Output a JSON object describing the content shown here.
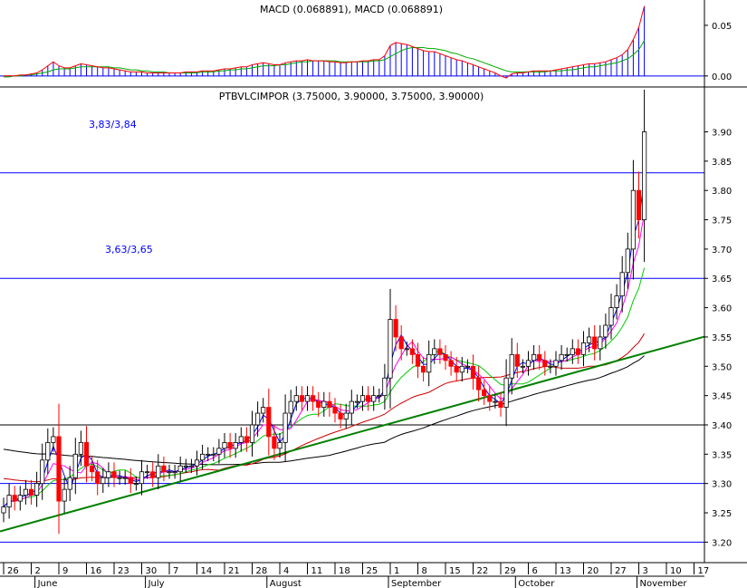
{
  "chart_data": {
    "type": "candlestick",
    "colors": {
      "background": "#ffffff",
      "frame": "#000000",
      "level_line": "#0000ff",
      "macd_histogram": "#0000ff",
      "macd_line": "#ff0000",
      "macd_signal": "#00aa00",
      "ma_fast": "#0000ff",
      "ma_mid": "#ff00ff",
      "ma_slow": "#00cc00",
      "ma_long": "#cc0000",
      "ma_longest": "#000000",
      "trendline": "#008000",
      "up_candle": "#ffffff",
      "down_candle": "#ff0000"
    },
    "macd_panel": {
      "title": "MACD (0.068891), MACD (0.068891)",
      "y_ticks": [
        "0.05",
        "0.00"
      ],
      "ylim": [
        -0.01,
        0.075
      ]
    },
    "price_panel": {
      "title": "PTBVLCIMPOR (3.75000, 3.90000, 3.75000, 3.90000)",
      "y_ticks": [
        "3.90",
        "3.85",
        "3.80",
        "3.75",
        "3.70",
        "3.65",
        "3.60",
        "3.55",
        "3.50",
        "3.45",
        "3.40",
        "3.35",
        "3.30",
        "3.25",
        "3.20"
      ],
      "ylim": [
        3.165,
        3.975
      ],
      "annotations": [
        {
          "text": "3,83/3,84",
          "value": 3.83
        },
        {
          "text": "3,63/3,65",
          "value": 3.65
        }
      ],
      "horizontal_levels": [
        3.83,
        3.65,
        3.4,
        3.3,
        3.2
      ],
      "trendline": {
        "start": [
          0,
          3.22
        ],
        "end": [
          119,
          3.53
        ]
      }
    },
    "x_axis": {
      "day_ticks": [
        {
          "label": "26",
          "i": 0
        },
        {
          "label": "2",
          "i": 5
        },
        {
          "label": "9",
          "i": 10
        },
        {
          "label": "16",
          "i": 15
        },
        {
          "label": "23",
          "i": 20
        },
        {
          "label": "30",
          "i": 25
        },
        {
          "label": "7",
          "i": 30
        },
        {
          "label": "14",
          "i": 35
        },
        {
          "label": "21",
          "i": 40
        },
        {
          "label": "28",
          "i": 45
        },
        {
          "label": "4",
          "i": 50
        },
        {
          "label": "11",
          "i": 55
        },
        {
          "label": "18",
          "i": 60
        },
        {
          "label": "25",
          "i": 65
        },
        {
          "label": "1",
          "i": 70
        },
        {
          "label": "8",
          "i": 75
        },
        {
          "label": "15",
          "i": 80
        },
        {
          "label": "22",
          "i": 85
        },
        {
          "label": "29",
          "i": 90
        },
        {
          "label": "6",
          "i": 95
        },
        {
          "label": "13",
          "i": 100
        },
        {
          "label": "20",
          "i": 105
        },
        {
          "label": "27",
          "i": 110
        },
        {
          "label": "3",
          "i": 115
        },
        {
          "label": "10",
          "i": 120
        },
        {
          "label": "17",
          "i": 125
        }
      ],
      "month_ticks": [
        {
          "label": "June",
          "i": 6
        },
        {
          "label": "July",
          "i": 26
        },
        {
          "label": "August",
          "i": 48
        },
        {
          "label": "September",
          "i": 70
        },
        {
          "label": "October",
          "i": 93
        },
        {
          "label": "November",
          "i": 115
        }
      ]
    },
    "close": [
      3.26,
      3.28,
      3.27,
      3.28,
      3.29,
      3.28,
      3.3,
      3.34,
      3.37,
      3.38,
      3.27,
      3.29,
      3.31,
      3.35,
      3.37,
      3.33,
      3.32,
      3.3,
      3.31,
      3.32,
      3.31,
      3.31,
      3.31,
      3.3,
      3.3,
      3.32,
      3.32,
      3.31,
      3.33,
      3.32,
      3.32,
      3.32,
      3.33,
      3.33,
      3.33,
      3.34,
      3.35,
      3.35,
      3.35,
      3.36,
      3.37,
      3.36,
      3.37,
      3.38,
      3.37,
      3.4,
      3.42,
      3.43,
      3.38,
      3.36,
      3.37,
      3.42,
      3.44,
      3.45,
      3.44,
      3.45,
      3.44,
      3.43,
      3.44,
      3.43,
      3.42,
      3.41,
      3.42,
      3.44,
      3.44,
      3.45,
      3.44,
      3.45,
      3.45,
      3.48,
      3.58,
      3.55,
      3.53,
      3.53,
      3.52,
      3.5,
      3.49,
      3.52,
      3.53,
      3.52,
      3.51,
      3.5,
      3.49,
      3.5,
      3.5,
      3.48,
      3.46,
      3.45,
      3.44,
      3.44,
      3.43,
      3.48,
      3.52,
      3.5,
      3.5,
      3.51,
      3.52,
      3.51,
      3.5,
      3.5,
      3.51,
      3.52,
      3.52,
      3.53,
      3.52,
      3.54,
      3.55,
      3.53,
      3.55,
      3.57,
      3.6,
      3.62,
      3.66,
      3.7,
      3.8,
      3.75,
      3.9
    ],
    "macd": [
      0.0,
      0.0,
      0.0,
      0.001,
      0.001,
      0.002,
      0.003,
      0.006,
      0.01,
      0.014,
      0.01,
      0.008,
      0.008,
      0.01,
      0.012,
      0.011,
      0.01,
      0.009,
      0.008,
      0.008,
      0.007,
      0.006,
      0.005,
      0.004,
      0.004,
      0.004,
      0.003,
      0.003,
      0.003,
      0.003,
      0.003,
      0.003,
      0.003,
      0.004,
      0.004,
      0.004,
      0.005,
      0.005,
      0.005,
      0.006,
      0.007,
      0.007,
      0.008,
      0.009,
      0.009,
      0.011,
      0.012,
      0.013,
      0.012,
      0.011,
      0.011,
      0.013,
      0.014,
      0.015,
      0.015,
      0.016,
      0.015,
      0.015,
      0.015,
      0.014,
      0.014,
      0.013,
      0.013,
      0.014,
      0.014,
      0.015,
      0.015,
      0.016,
      0.016,
      0.02,
      0.03,
      0.033,
      0.032,
      0.031,
      0.029,
      0.027,
      0.025,
      0.024,
      0.024,
      0.022,
      0.02,
      0.018,
      0.016,
      0.015,
      0.013,
      0.011,
      0.009,
      0.007,
      0.005,
      0.003,
      0.0,
      -0.002,
      0.002,
      0.003,
      0.003,
      0.004,
      0.005,
      0.005,
      0.005,
      0.005,
      0.006,
      0.007,
      0.008,
      0.009,
      0.01,
      0.011,
      0.012,
      0.012,
      0.013,
      0.014,
      0.016,
      0.018,
      0.021,
      0.026,
      0.036,
      0.048,
      0.069
    ],
    "signal": [
      -0.001,
      -0.001,
      0.0,
      0.0,
      0.001,
      0.001,
      0.002,
      0.003,
      0.004,
      0.006,
      0.007,
      0.007,
      0.007,
      0.008,
      0.009,
      0.009,
      0.009,
      0.009,
      0.009,
      0.009,
      0.008,
      0.008,
      0.007,
      0.006,
      0.006,
      0.005,
      0.005,
      0.004,
      0.004,
      0.004,
      0.003,
      0.003,
      0.003,
      0.003,
      0.003,
      0.003,
      0.004,
      0.004,
      0.004,
      0.005,
      0.005,
      0.006,
      0.006,
      0.007,
      0.007,
      0.008,
      0.009,
      0.01,
      0.01,
      0.01,
      0.011,
      0.011,
      0.012,
      0.013,
      0.014,
      0.014,
      0.015,
      0.015,
      0.015,
      0.015,
      0.015,
      0.014,
      0.014,
      0.014,
      0.014,
      0.014,
      0.014,
      0.015,
      0.015,
      0.016,
      0.019,
      0.022,
      0.025,
      0.027,
      0.028,
      0.028,
      0.028,
      0.027,
      0.027,
      0.026,
      0.025,
      0.023,
      0.022,
      0.02,
      0.018,
      0.017,
      0.015,
      0.013,
      0.011,
      0.009,
      0.007,
      0.005,
      0.004,
      0.004,
      0.004,
      0.004,
      0.004,
      0.004,
      0.004,
      0.005,
      0.005,
      0.005,
      0.006,
      0.006,
      0.007,
      0.008,
      0.009,
      0.009,
      0.01,
      0.011,
      0.012,
      0.013,
      0.015,
      0.017,
      0.021,
      0.026,
      0.035
    ]
  }
}
